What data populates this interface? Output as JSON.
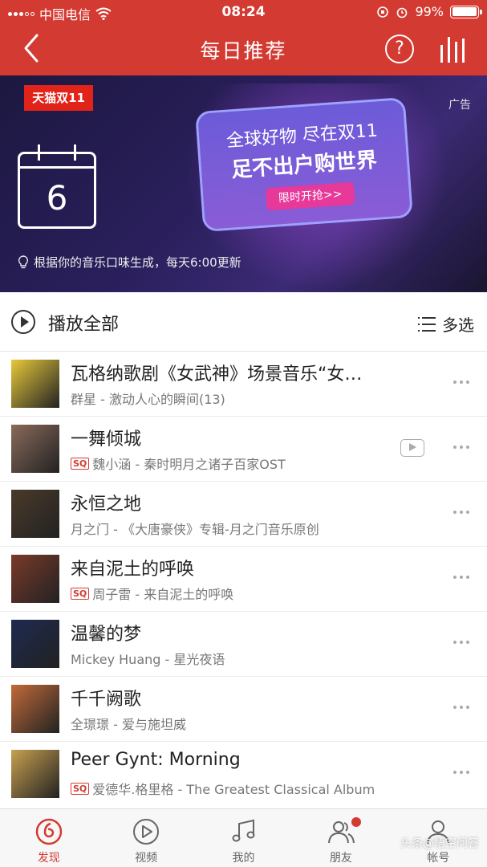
{
  "status": {
    "carrier": "中国电信",
    "time": "08:24",
    "battery": "99%",
    "battery_level": 0.99
  },
  "header": {
    "title": "每日推荐",
    "help_icon": "help-icon",
    "back_icon": "back-icon",
    "bars_icon": "equalizer-icon"
  },
  "banner": {
    "logo_text": "天猫双11",
    "ad_label": "广告",
    "day": "6",
    "headline1": "全球好物 尽在双11",
    "headline2": "足不出户购世界",
    "cta": "限时开抢>>",
    "note": "根据你的音乐口味生成，每天6:00更新"
  },
  "playall": {
    "label": "播放全部",
    "multi_select": "多选"
  },
  "songs": [
    {
      "title": "瓦格纳歌剧《女武神》场景音乐“女…",
      "sq": "",
      "subtitle": "群星 - 激动人心的瞬间(13)",
      "mv": false,
      "cover_color": "#e8c93a"
    },
    {
      "title": "一舞倾城",
      "sq": "SQ",
      "subtitle": "魏小涵 - 秦时明月之诸子百家OST",
      "mv": true,
      "cover_color": "#8a6a5a"
    },
    {
      "title": "永恒之地",
      "sq": "",
      "subtitle": "月之门 - 《大唐豪侠》专辑-月之门音乐原创",
      "mv": false,
      "cover_color": "#4a3a2a"
    },
    {
      "title": "来自泥土的呼唤",
      "sq": "SQ",
      "subtitle": "周子雷 - 来自泥土的呼唤",
      "mv": false,
      "cover_color": "#7a3a2a"
    },
    {
      "title": "温馨的梦",
      "sq": "",
      "subtitle": "Mickey Huang - 星光夜语",
      "mv": false,
      "cover_color": "#1e2a50"
    },
    {
      "title": "千千阙歌",
      "sq": "",
      "subtitle": "全璟璟 - 爱与施坦威",
      "mv": false,
      "cover_color": "#c26a3a"
    },
    {
      "title": "Peer Gynt: Morning",
      "sq": "SQ",
      "subtitle": "爱德华.格里格 - The Greatest Classical Album",
      "mv": false,
      "cover_color": "#c8a050"
    }
  ],
  "tabs": [
    {
      "label": "发现",
      "icon": "discover-icon",
      "active": true
    },
    {
      "label": "视频",
      "icon": "video-icon",
      "active": false
    },
    {
      "label": "我的",
      "icon": "music-icon",
      "active": false
    },
    {
      "label": "朋友",
      "icon": "friends-icon",
      "active": false,
      "badge": true
    },
    {
      "label": "帐号",
      "icon": "account-icon",
      "active": false
    }
  ],
  "watermark": "头条@悟空问答",
  "colors": {
    "brand": "#d33a31",
    "text": "#222222",
    "muted": "#777777"
  }
}
